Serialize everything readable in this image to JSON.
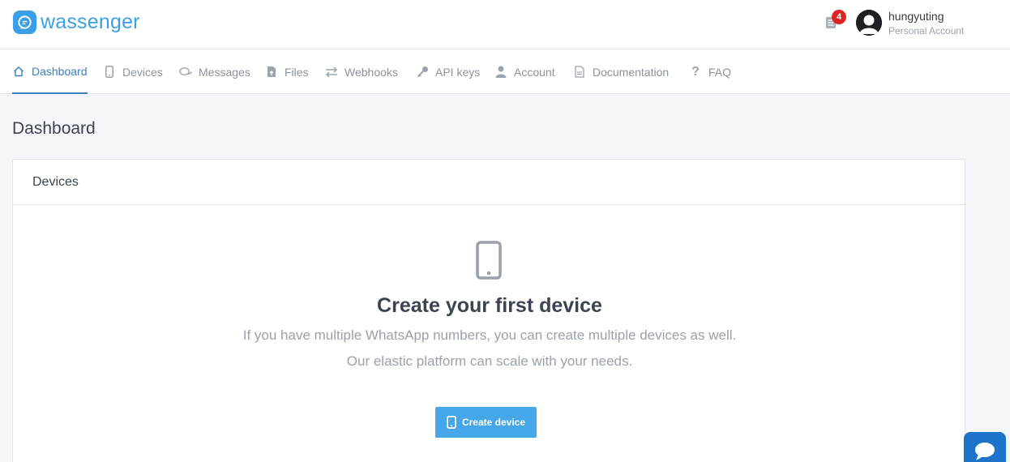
{
  "brand": {
    "name": "wassenger",
    "color": "#3b9fe8"
  },
  "header": {
    "notification_icon": "tasks-icon",
    "notification_count": "4",
    "user": {
      "name": "hungyuting",
      "account_type": "Personal Account"
    }
  },
  "nav": {
    "items": [
      {
        "label": "Dashboard",
        "icon": "home-icon",
        "active": true
      },
      {
        "label": "Devices",
        "icon": "mobile-icon",
        "active": false
      },
      {
        "label": "Messages",
        "icon": "comments-icon",
        "active": false
      },
      {
        "label": "Files",
        "icon": "file-upload-icon",
        "active": false
      },
      {
        "label": "Webhooks",
        "icon": "exchange-icon",
        "active": false
      },
      {
        "label": "API keys",
        "icon": "key-icon",
        "active": false
      },
      {
        "label": "Account",
        "icon": "user-icon",
        "active": false
      },
      {
        "label": "Documentation",
        "icon": "document-icon",
        "active": false
      },
      {
        "label": "FAQ",
        "icon": "question-icon",
        "active": false
      }
    ]
  },
  "page": {
    "title": "Dashboard"
  },
  "devices_card": {
    "title": "Devices",
    "empty_icon": "mobile-icon",
    "empty_title": "Create your first device",
    "empty_line1": "If you have multiple WhatsApp numbers, you can create multiple devices as well.",
    "empty_line2": "Our elastic platform can scale with your needs.",
    "button_label": "Create device",
    "button_color": "#45a7ea"
  },
  "chat_widget": {
    "icon": "chat-bubble-icon",
    "color": "#1d73c9"
  }
}
